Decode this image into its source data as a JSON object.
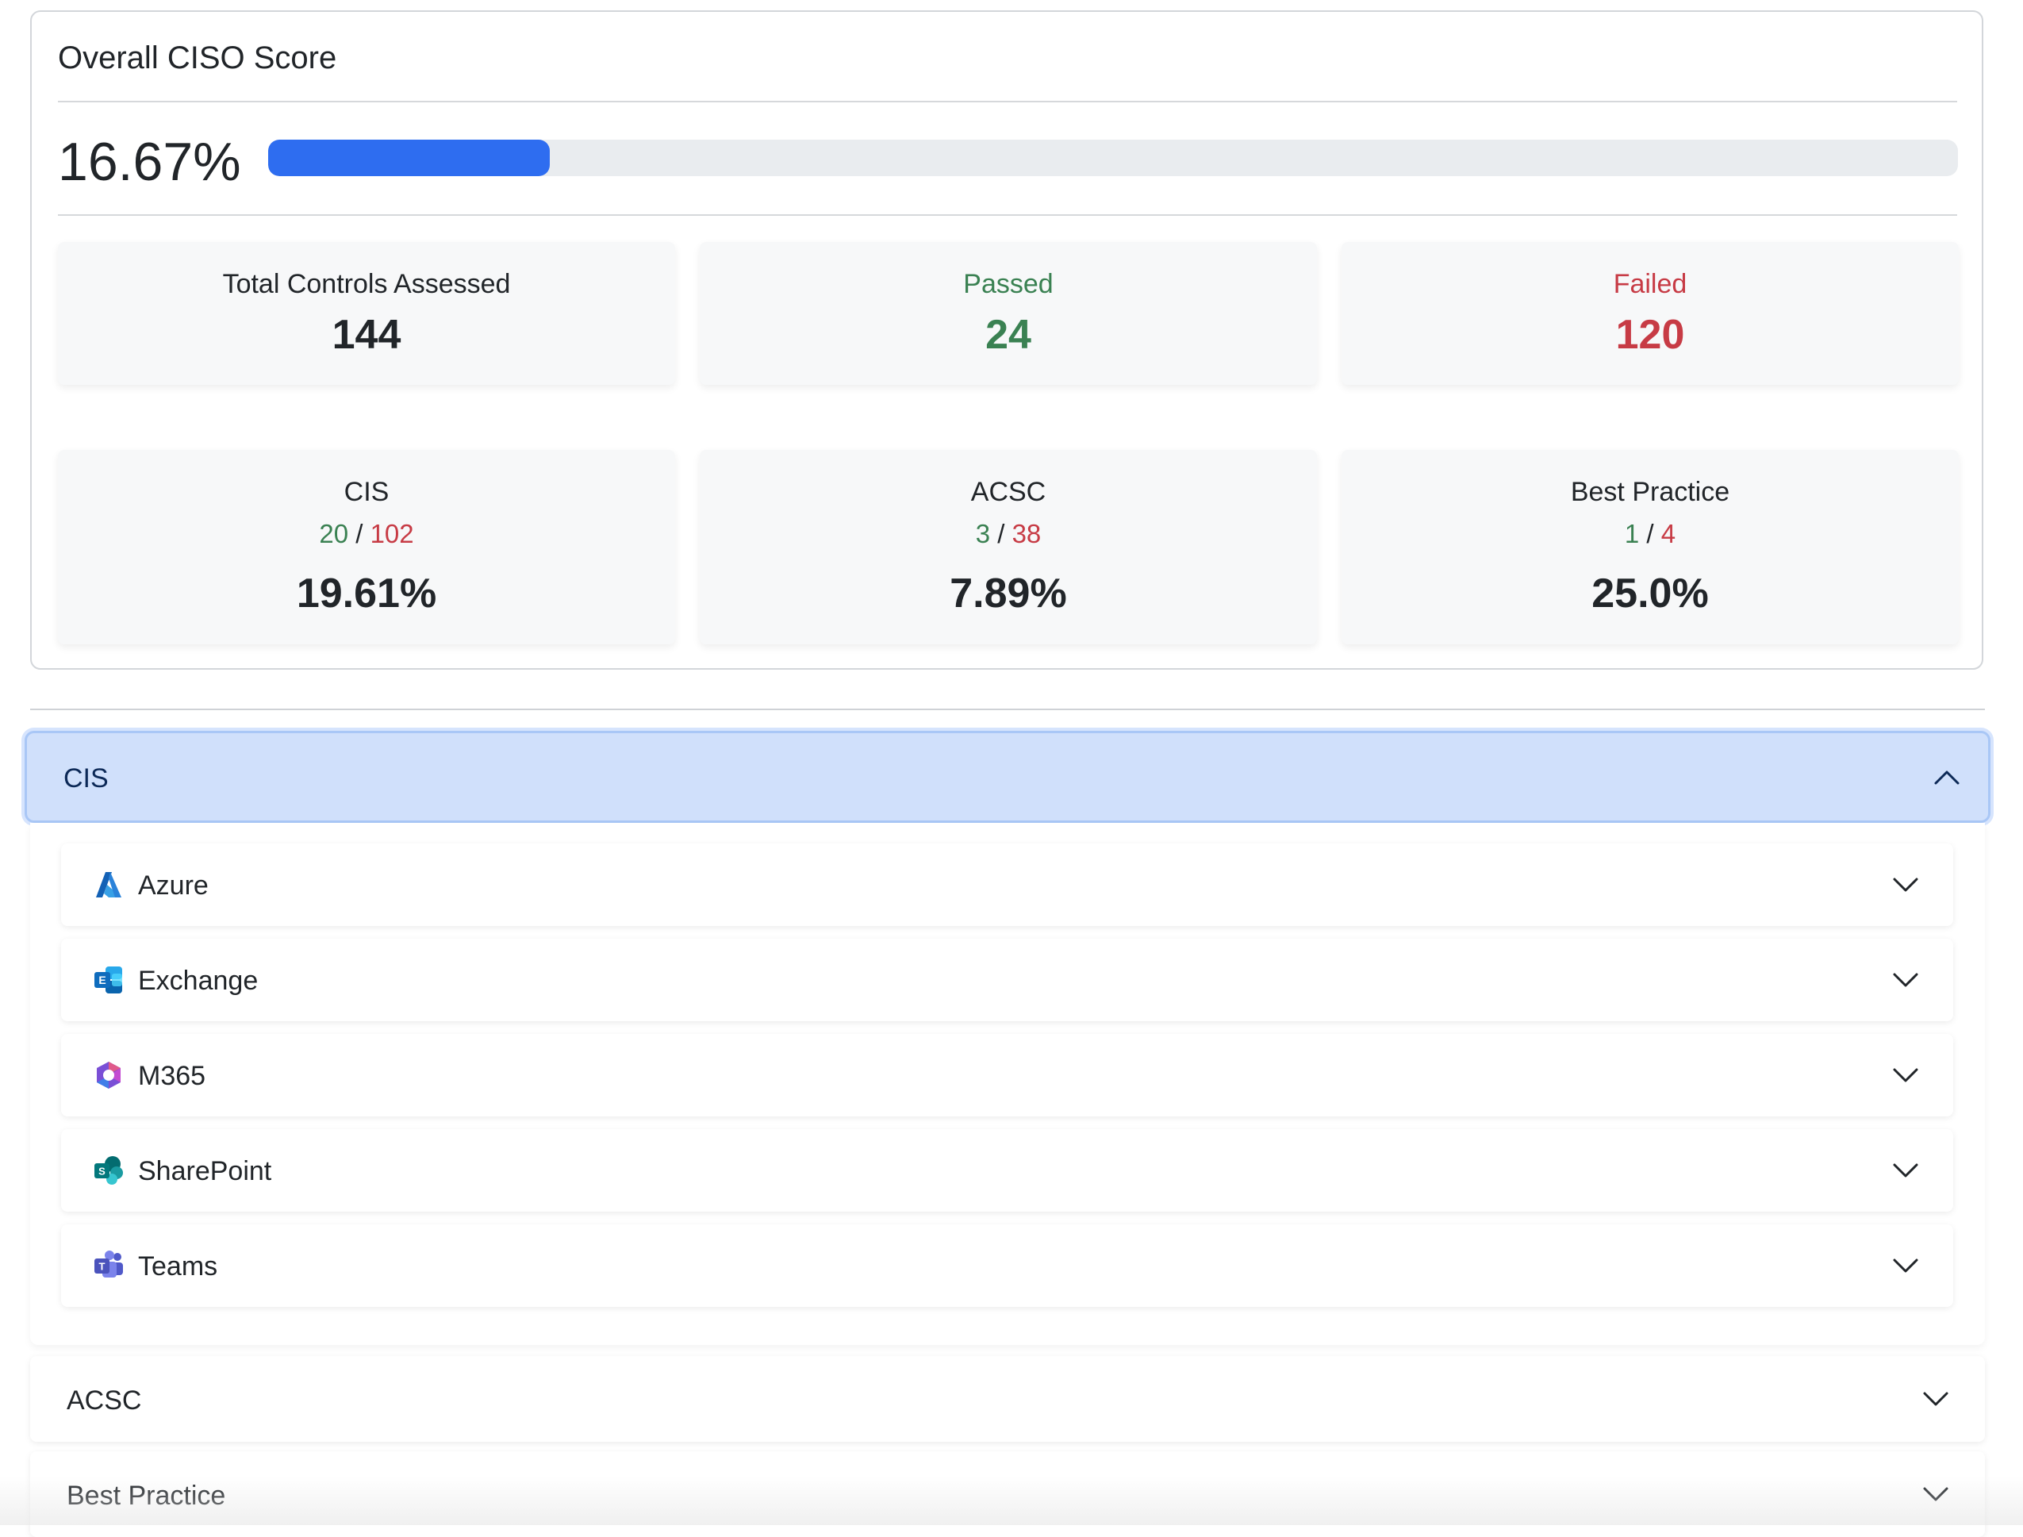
{
  "score": {
    "title": "Overall CISO Score",
    "value": "16.67%",
    "progress_percent": 16.67,
    "progress_color": "#2e6df0"
  },
  "stats": {
    "total": {
      "label": "Total Controls Assessed",
      "value": "144"
    },
    "passed": {
      "label": "Passed",
      "value": "24"
    },
    "failed": {
      "label": "Failed",
      "value": "120"
    }
  },
  "frameworks": [
    {
      "name": "CIS",
      "passed": "20",
      "sep": "/",
      "failed": "102",
      "percent": "19.61%"
    },
    {
      "name": "ACSC",
      "passed": "3",
      "sep": "/",
      "failed": "38",
      "percent": "7.89%"
    },
    {
      "name": "Best Practice",
      "passed": "1",
      "sep": "/",
      "failed": "4",
      "percent": "25.0%"
    }
  ],
  "accordion": {
    "cis": {
      "label": "CIS",
      "expanded": true,
      "items": [
        {
          "label": "Azure",
          "icon": "azure-icon"
        },
        {
          "label": "Exchange",
          "icon": "exchange-icon"
        },
        {
          "label": "M365",
          "icon": "m365-icon"
        },
        {
          "label": "SharePoint",
          "icon": "sharepoint-icon"
        },
        {
          "label": "Teams",
          "icon": "teams-icon"
        }
      ]
    },
    "acsc": {
      "label": "ACSC",
      "expanded": false
    },
    "best_practice": {
      "label": "Best Practice",
      "expanded": false
    }
  },
  "colors": {
    "passed": "#3a8152",
    "failed": "#c73b45",
    "active_header_bg": "#d0e0fb"
  }
}
